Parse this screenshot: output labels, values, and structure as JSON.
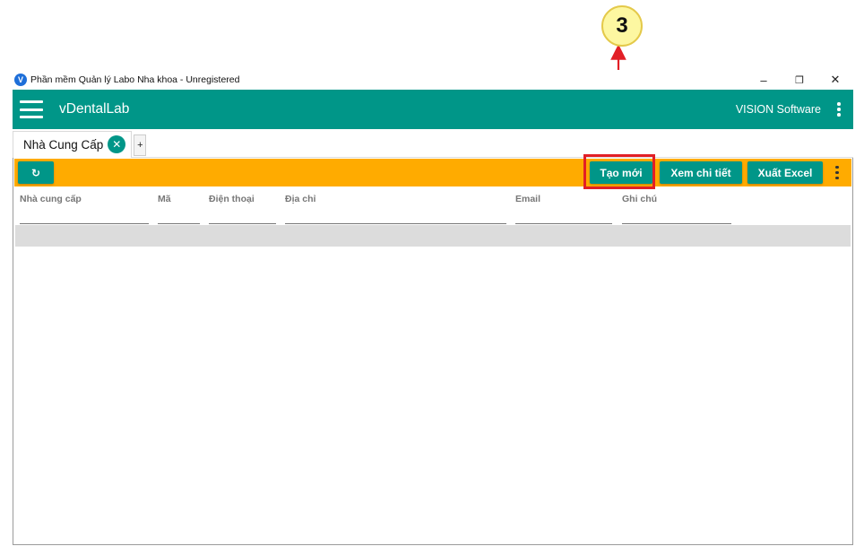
{
  "callout": {
    "number": "3",
    "color": "#e21f26"
  },
  "window": {
    "title": "Phần mềm Quản lý Labo Nha khoa - Unregistered",
    "controls": {
      "minimize": "–",
      "restore": "❐",
      "close": "✕"
    }
  },
  "appbar": {
    "app_name": "vDentalLab",
    "vendor": "VISION Software",
    "color": "#009688"
  },
  "tabs": [
    {
      "label": "Nhà Cung Cấp",
      "close": "✕"
    }
  ],
  "tab_add": "+",
  "toolbar": {
    "color": "#ffab00",
    "refresh_icon": "↻",
    "create_label": "Tạo mới",
    "detail_label": "Xem chi tiết",
    "excel_label": "Xuất Excel"
  },
  "grid": {
    "columns": [
      "Nhà cung cấp",
      "Mã",
      "Điện thoại",
      "Địa chỉ",
      "Email",
      "Ghi chú"
    ],
    "filters": [
      "",
      "",
      "",
      "",
      "",
      ""
    ]
  }
}
